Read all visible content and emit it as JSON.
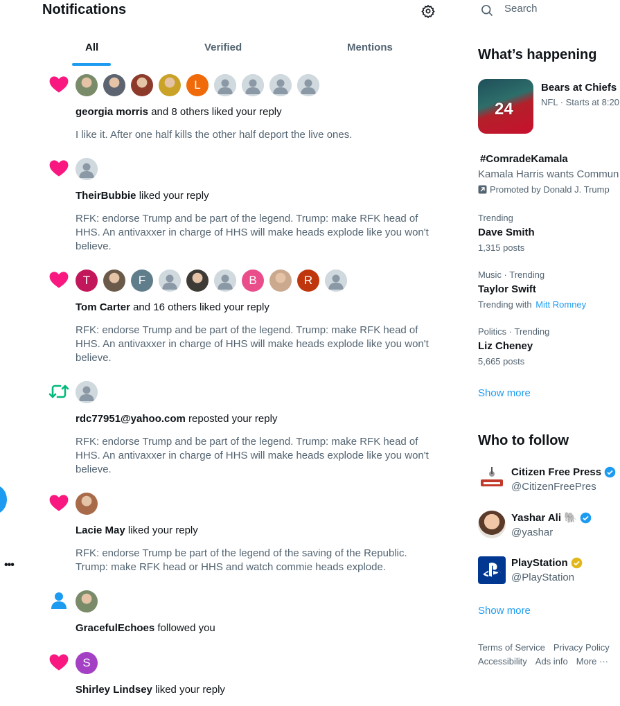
{
  "header": {
    "title": "Notifications",
    "settings_icon": "gear-icon"
  },
  "tabs": [
    {
      "label": "All",
      "active": true
    },
    {
      "label": "Verified",
      "active": false
    },
    {
      "label": "Mentions",
      "active": false
    }
  ],
  "notifications": [
    {
      "type": "like",
      "icon": "heart-icon",
      "avatars": [
        "photo",
        "photo",
        "photo",
        "photo",
        "L",
        "default",
        "default",
        "default",
        "default"
      ],
      "actor": "georgia morris",
      "action": "and 8 others liked your reply",
      "body": "I like it.  After one half kills the other half deport the live ones."
    },
    {
      "type": "like",
      "icon": "heart-icon",
      "avatars": [
        "default"
      ],
      "actor": "TheirBubbie",
      "action": "liked your reply",
      "body": "RFK: endorse Trump and be part of the legend.  Trump: make RFK head of HHS.  An antivaxxer in charge of HHS will make heads explode like you won't believe."
    },
    {
      "type": "like",
      "icon": "heart-icon",
      "avatars": [
        "T",
        "photo",
        "F",
        "default",
        "photo",
        "default",
        "B",
        "photo",
        "R",
        "default"
      ],
      "actor": "Tom Carter",
      "action": "and 16 others liked your reply",
      "body": "RFK: endorse Trump and be part of the legend.  Trump: make RFK head of HHS.  An antivaxxer in charge of HHS will make heads explode like you won't believe."
    },
    {
      "type": "repost",
      "icon": "repost-icon",
      "avatars": [
        "default"
      ],
      "actor": "rdc77951@yahoo.com",
      "action": "reposted your reply",
      "body": "RFK: endorse Trump and be part of the legend.  Trump: make RFK head of HHS.  An antivaxxer in charge of HHS will make heads explode like you won't believe."
    },
    {
      "type": "like",
      "icon": "heart-icon",
      "avatars": [
        "photo"
      ],
      "actor": "Lacie May",
      "action": "liked your reply",
      "body": "RFK: endorse Trump be part of the legend of the saving of the Republic.  Trump: make RFK head or HHS and watch commie heads explode."
    },
    {
      "type": "follow",
      "icon": "person-icon",
      "avatars": [
        "photo"
      ],
      "actor": "GracefulEchoes",
      "action": "followed you",
      "body": ""
    },
    {
      "type": "like",
      "icon": "heart-icon",
      "avatars": [
        "S"
      ],
      "actor": "Shirley Lindsey",
      "action": "liked your reply",
      "body": ""
    }
  ],
  "search": {
    "placeholder": "Search"
  },
  "happening": {
    "title": "What’s happening",
    "sport": {
      "title": "Bears at Chiefs",
      "meta": "NFL · Starts at 8:20",
      "jersey": "24"
    },
    "promoted": {
      "name": "#ComradeKamala",
      "desc": "Kamala Harris wants Commun",
      "promoted_by": "Promoted by Donald J. Trump"
    },
    "trends": [
      {
        "meta": "Trending",
        "name": "Dave Smith",
        "sub": "1,315 posts",
        "sub_link": ""
      },
      {
        "meta": "Music · Trending",
        "name": "Taylor Swift",
        "sub": "Trending with",
        "sub_link": "Mitt Romney"
      },
      {
        "meta": "Politics · Trending",
        "name": "Liz Cheney",
        "sub": "5,665 posts",
        "sub_link": ""
      }
    ],
    "show_more": "Show more"
  },
  "who_to_follow": {
    "title": "Who to follow",
    "accounts": [
      {
        "name": "Citizen Free Press",
        "handle": "@CitizenFreePres",
        "badge": "blue-check"
      },
      {
        "name": "Yashar Ali 🐘",
        "handle": "@yashar",
        "badge": "blue-check"
      },
      {
        "name": "PlayStation",
        "handle": "@PlayStation",
        "badge": "gold-check"
      }
    ],
    "show_more": "Show more"
  },
  "footer": {
    "row1": [
      "Terms of Service",
      "Privacy Policy"
    ],
    "row2": [
      "Accessibility",
      "Ads info",
      "More ···"
    ]
  },
  "colors": {
    "accent": "#1d9bf0",
    "like": "#f91880",
    "repost": "#00ba7c",
    "muted": "#536471"
  }
}
